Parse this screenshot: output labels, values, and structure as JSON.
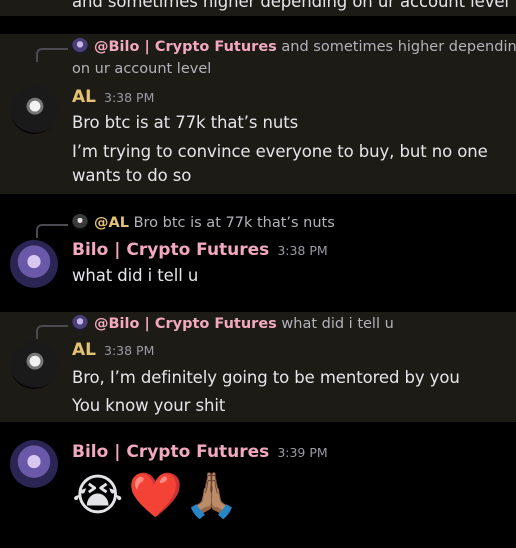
{
  "top_cut_text": "and sometimes higher depending on ur account level",
  "messages": [
    {
      "reply": {
        "mention": "@Bilo | Crypto Futures",
        "text": "and sometimes higher depending",
        "text_wrap": "on ur account level"
      },
      "author": "AL",
      "time": "3:38 PM",
      "lines": [
        "Bro btc is at 77k that’s nuts",
        "I’m trying to convince everyone to buy, but no one",
        "wants  to do so"
      ]
    },
    {
      "reply": {
        "mention": "@AL",
        "text": "Bro btc is at 77k that’s nuts"
      },
      "author": "Bilo | Crypto Futures",
      "time": "3:38 PM",
      "lines": [
        "what did i tell u"
      ]
    },
    {
      "reply": {
        "mention": "@Bilo | Crypto Futures",
        "text": "what did i tell u"
      },
      "author": "AL",
      "time": "3:38 PM",
      "lines": [
        "Bro, I’m definitely going to be mentored by you",
        "You know your shit"
      ]
    },
    {
      "author": "Bilo | Crypto Futures",
      "time": "3:39 PM",
      "emojis": [
        "😭",
        "❤️",
        "🙏🏽"
      ]
    }
  ],
  "colors": {
    "background": "#000000",
    "highlight": "#1c1b15",
    "al_name": "#e3c272",
    "bilo_name": "#f2a9bf"
  }
}
